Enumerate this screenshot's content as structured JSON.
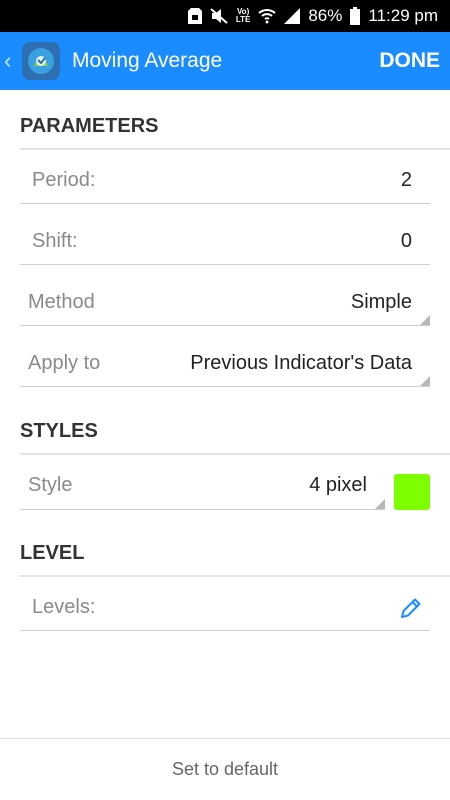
{
  "status_bar": {
    "battery": "86%",
    "time": "11:29 pm",
    "volte_label": "VoLTE"
  },
  "appbar": {
    "title": "Moving Average",
    "done_label": "DONE",
    "color": "#1a8cff"
  },
  "parameters": {
    "header": "PARAMETERS",
    "period": {
      "label": "Period:",
      "value": "2"
    },
    "shift": {
      "label": "Shift:",
      "value": "0"
    },
    "method": {
      "label": "Method",
      "value": "Simple"
    },
    "apply_to": {
      "label": "Apply to",
      "value": "Previous Indicator's Data"
    }
  },
  "styles": {
    "header": "STYLES",
    "style": {
      "label": "Style",
      "value": "4 pixel"
    },
    "color": "#7dff00"
  },
  "level": {
    "header": "LEVEL",
    "levels_label": "Levels:"
  },
  "footer": {
    "set_default_label": "Set to default"
  }
}
